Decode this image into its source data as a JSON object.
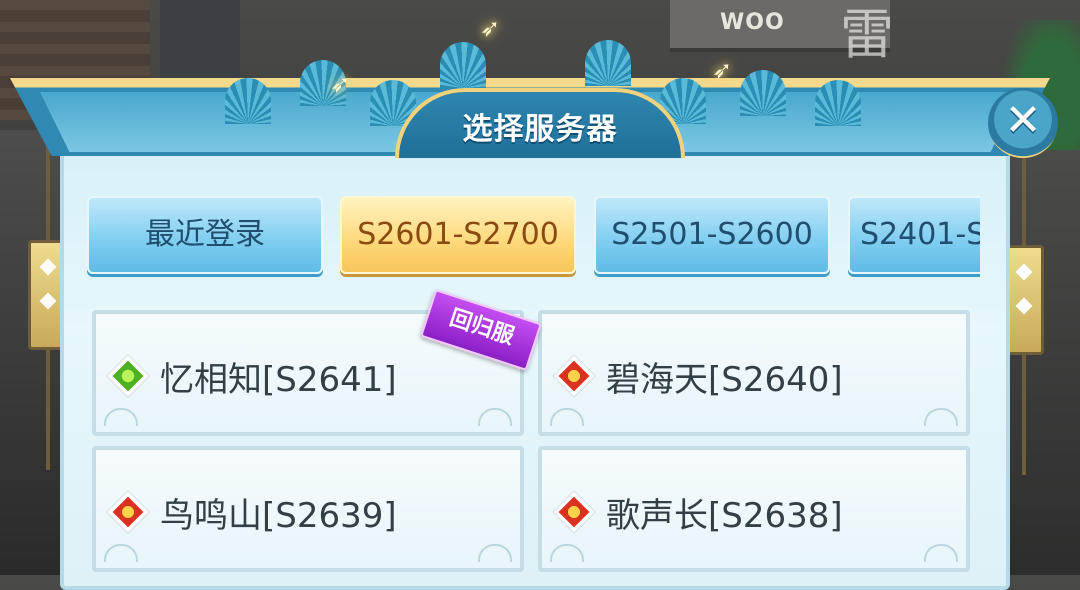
{
  "background": {
    "sign_text": "WOO",
    "brush_text": "雷"
  },
  "dialog": {
    "title": "选择服务器",
    "close_label": "✕"
  },
  "tabs": [
    {
      "label": "最近登录",
      "active": false
    },
    {
      "label": "S2601-S2700",
      "active": true
    },
    {
      "label": "S2501-S2600",
      "active": false
    },
    {
      "label": "S2401-S",
      "active": false
    }
  ],
  "servers": [
    {
      "name": "忆相知[S2641]",
      "status": "green",
      "badge": "回归服"
    },
    {
      "name": "碧海天[S2640]",
      "status": "red"
    },
    {
      "name": "鸟鸣山[S2639]",
      "status": "red"
    },
    {
      "name": "歌声长[S2638]",
      "status": "red"
    }
  ],
  "colors": {
    "tab_active": "#ffd87a",
    "tab_normal": "#7ecdf0",
    "status_green": "#4db01e",
    "status_red": "#d9321f",
    "badge": "#a33ad8"
  }
}
